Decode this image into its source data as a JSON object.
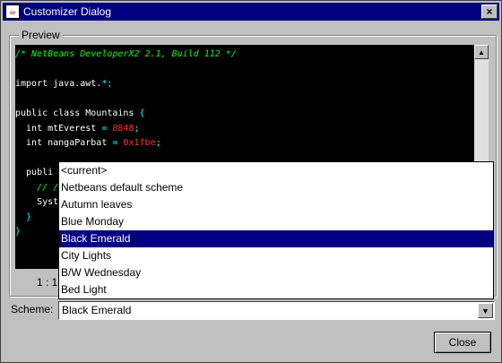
{
  "window": {
    "title": "Customizer Dialog",
    "close_glyph": "×",
    "app_icon": "java-cup-icon"
  },
  "preview": {
    "legend": "Preview",
    "status": "1 : 1",
    "code": [
      {
        "parts": [
          {
            "t": "/* NetBeans DeveloperX2 2.1, Build 112 */",
            "c": "comment"
          }
        ]
      },
      {
        "parts": []
      },
      {
        "parts": [
          {
            "t": "import java.awt.",
            "c": "kw"
          },
          {
            "t": "*",
            "c": "op"
          },
          {
            "t": ";",
            "c": "op"
          }
        ]
      },
      {
        "parts": []
      },
      {
        "parts": [
          {
            "t": "public class Mountains ",
            "c": "kw"
          },
          {
            "t": "{",
            "c": "op"
          }
        ]
      },
      {
        "parts": [
          {
            "t": "  int mtEverest ",
            "c": "kw"
          },
          {
            "t": "=",
            "c": "op"
          },
          {
            "t": " 8848",
            "c": "num"
          },
          {
            "t": ";",
            "c": "op"
          }
        ]
      },
      {
        "parts": [
          {
            "t": "  int nangaParbat ",
            "c": "kw"
          },
          {
            "t": "=",
            "c": "op"
          },
          {
            "t": " 0x1fbe",
            "c": "num"
          },
          {
            "t": ";",
            "c": "op"
          }
        ]
      },
      {
        "parts": []
      },
      {
        "parts": [
          {
            "t": "  publi",
            "c": "kw"
          }
        ]
      },
      {
        "parts": [
          {
            "t": "    // /",
            "c": "comment"
          }
        ]
      },
      {
        "parts": [
          {
            "t": "    Syst",
            "c": "kw"
          }
        ]
      },
      {
        "parts": [
          {
            "t": "  }",
            "c": "op"
          }
        ]
      },
      {
        "parts": [
          {
            "t": "}",
            "c": "op"
          }
        ]
      }
    ]
  },
  "scheme": {
    "label": "Scheme:",
    "selected": "Black Emerald",
    "options": [
      "<current>",
      "Netbeans default scheme",
      "Autumn leaves",
      "Blue Monday",
      "Black Emerald",
      "City Lights",
      "B/W Wednesday",
      "Bed Light"
    ],
    "highlighted_index": 4
  },
  "buttons": {
    "close_label": "Close"
  },
  "colors": {
    "titlebar": "#000080",
    "editor_bg": "#000000",
    "comment": "#00ff00",
    "number": "#ff3030",
    "operator": "#00ffff"
  }
}
